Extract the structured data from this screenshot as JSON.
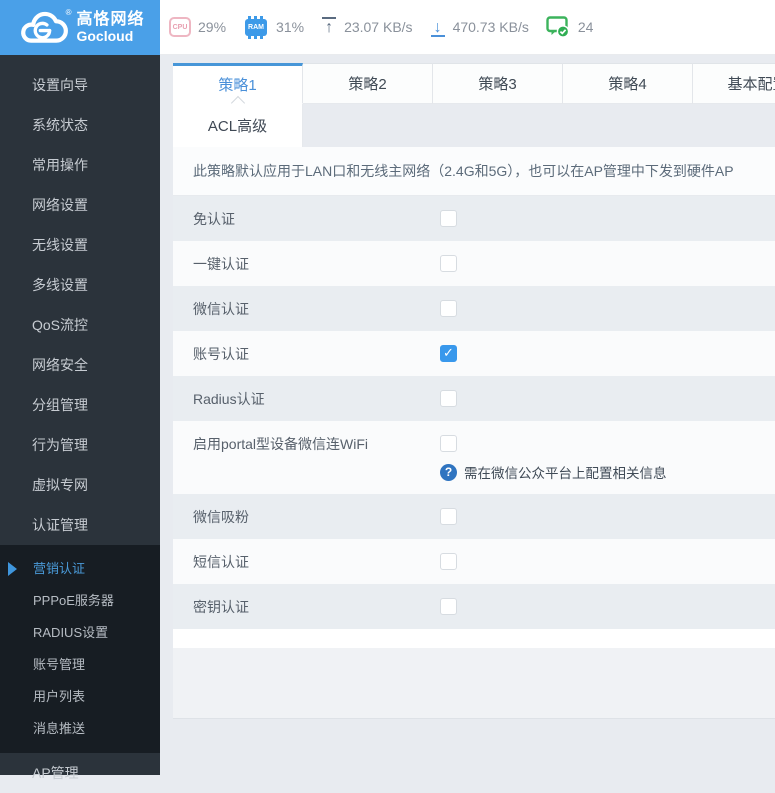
{
  "logo": {
    "title": "高恪网络",
    "subtitle": "Gocloud",
    "reg": "®"
  },
  "topbar": {
    "cpu_icon_label": "CPU",
    "cpu_value": "29%",
    "ram_icon_label": "RAM",
    "ram_value": "31%",
    "upload_icon": "↑",
    "upload_value": "23.07 KB/s",
    "download_icon": "↓",
    "download_value": "470.73 KB/s",
    "online_count": "24"
  },
  "sidebar": {
    "items": [
      {
        "label": "设置向导"
      },
      {
        "label": "系统状态"
      },
      {
        "label": "常用操作"
      },
      {
        "label": "网络设置"
      },
      {
        "label": "无线设置"
      },
      {
        "label": "多线设置"
      },
      {
        "label": "QoS流控"
      },
      {
        "label": "网络安全"
      },
      {
        "label": "分组管理"
      },
      {
        "label": "行为管理"
      },
      {
        "label": "虚拟专网"
      },
      {
        "label": "认证管理"
      }
    ],
    "submenu": [
      {
        "label": "营销认证",
        "active": true
      },
      {
        "label": "PPPoE服务器",
        "active": false
      },
      {
        "label": "RADIUS设置",
        "active": false
      },
      {
        "label": "账号管理",
        "active": false
      },
      {
        "label": "用户列表",
        "active": false
      },
      {
        "label": "消息推送",
        "active": false
      }
    ],
    "bottom_item": "AP管理"
  },
  "tabs": {
    "row1": [
      {
        "label": "策略1",
        "active": true
      },
      {
        "label": "策略2",
        "active": false
      },
      {
        "label": "策略3",
        "active": false
      },
      {
        "label": "策略4",
        "active": false
      },
      {
        "label": "基本配置",
        "active": false
      }
    ],
    "row2": {
      "label": "ACL高级"
    }
  },
  "content": {
    "notice": "此策略默认应用于LAN口和无线主网络（2.4G和5G），也可以在AP管理中下发到硬件AP",
    "help_icon": "?",
    "rows": [
      {
        "label": "免认证",
        "checked": false
      },
      {
        "label": "一键认证",
        "checked": false
      },
      {
        "label": "微信认证",
        "checked": false
      },
      {
        "label": "账号认证",
        "checked": true
      },
      {
        "label": "Radius认证",
        "checked": false
      },
      {
        "label": "启用portal型设备微信连WiFi",
        "checked": false,
        "note": "需在微信公众平台上配置相关信息"
      },
      {
        "label": "微信吸粉",
        "checked": false
      },
      {
        "label": "短信认证",
        "checked": false
      },
      {
        "label": "密钥认证",
        "checked": false
      }
    ]
  },
  "colors": {
    "brand_blue": "#4aa0e8",
    "accent_blue": "#4a90d9",
    "check_blue": "#3898ec",
    "sidebar_bg": "#2b333b",
    "submenu_bg": "#171d23",
    "cpu_pink": "#e8a0b1",
    "ram_blue": "#3d9ae8",
    "online_green": "#2fae53",
    "row_gray": "#e9edf1"
  }
}
